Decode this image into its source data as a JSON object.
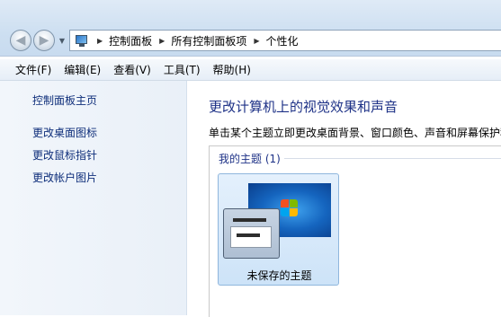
{
  "breadcrumb": {
    "items": [
      "控制面板",
      "所有控制面板项",
      "个性化"
    ]
  },
  "menubar": {
    "items": [
      "文件(F)",
      "编辑(E)",
      "查看(V)",
      "工具(T)",
      "帮助(H)"
    ]
  },
  "sidebar": {
    "home": "控制面板主页",
    "links": [
      "更改桌面图标",
      "更改鼠标指针",
      "更改帐户图片"
    ]
  },
  "main": {
    "title": "更改计算机上的视觉效果和声音",
    "description": "单击某个主题立即更改桌面背景、窗口颜色、声音和屏幕保护程",
    "group_label": "我的主题 (1)",
    "themes": [
      {
        "label": "未保存的主题",
        "selected": true
      }
    ]
  },
  "icons": {
    "back": "back-arrow-icon",
    "forward": "forward-arrow-icon",
    "address": "control-panel-icon"
  }
}
